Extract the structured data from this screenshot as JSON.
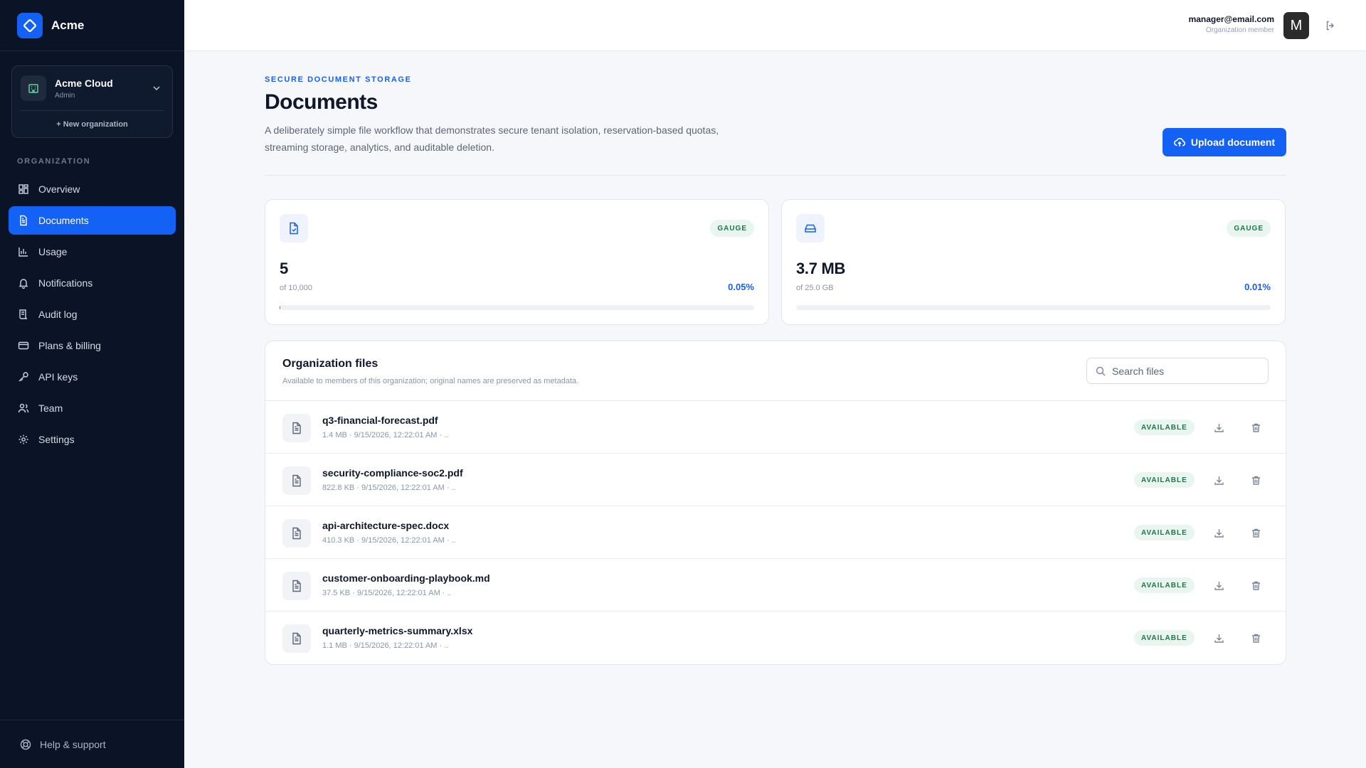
{
  "brand": {
    "name": "Acme",
    "icon": "diamond-logo-icon"
  },
  "organization": {
    "name": "Acme Cloud",
    "role": "Admin",
    "new_label": "+ New organization"
  },
  "sidebar": {
    "heading": "ORGANIZATION",
    "items": [
      {
        "label": "Overview",
        "icon": "grid-icon",
        "active": false
      },
      {
        "label": "Documents",
        "icon": "document-icon",
        "active": true
      },
      {
        "label": "Usage",
        "icon": "bar-chart-icon",
        "active": false
      },
      {
        "label": "Notifications",
        "icon": "bell-icon",
        "active": false
      },
      {
        "label": "Audit log",
        "icon": "scroll-icon",
        "active": false
      },
      {
        "label": "Plans & billing",
        "icon": "credit-card-icon",
        "active": false
      },
      {
        "label": "API keys",
        "icon": "key-icon",
        "active": false
      },
      {
        "label": "Team",
        "icon": "users-icon",
        "active": false
      },
      {
        "label": "Settings",
        "icon": "gear-icon",
        "active": false
      }
    ],
    "footer_label": "Help & support"
  },
  "user": {
    "email": "manager@email.com",
    "role": "Organization member",
    "initial": "M"
  },
  "header": {
    "eyebrow": "SECURE DOCUMENT STORAGE",
    "title": "Documents",
    "description": "A deliberately simple file workflow that demonstrates secure tenant isolation, reservation-based quotas, streaming storage, analytics, and auditable deletion.",
    "upload_label": "Upload document"
  },
  "stats": [
    {
      "icon": "file-check-icon",
      "badge": "GAUGE",
      "value": "5",
      "of": "of 10,000",
      "percent": "0.05%",
      "fill_fraction": 0.0005
    },
    {
      "icon": "hard-drive-icon",
      "badge": "GAUGE",
      "value": "3.7 MB",
      "of": "of 25.0 GB",
      "percent": "0.01%",
      "fill_fraction": 0.0001
    }
  ],
  "files": {
    "title": "Organization files",
    "subtitle": "Available to members of this organization; original names are preserved as metadata.",
    "search_placeholder": "Search files",
    "items": [
      {
        "name": "q3-financial-forecast.pdf",
        "meta": "1.4 MB · 9/15/2026, 12:22:01 AM · ..",
        "status": "AVAILABLE"
      },
      {
        "name": "security-compliance-soc2.pdf",
        "meta": "822.8 KB · 9/15/2026, 12:22:01 AM · ..",
        "status": "AVAILABLE"
      },
      {
        "name": "api-architecture-spec.docx",
        "meta": "410.3 KB · 9/15/2026, 12:22:01 AM · ..",
        "status": "AVAILABLE"
      },
      {
        "name": "customer-onboarding-playbook.md",
        "meta": "37.5 KB · 9/15/2026, 12:22:01 AM · ..",
        "status": "AVAILABLE"
      },
      {
        "name": "quarterly-metrics-summary.xlsx",
        "meta": "1.1 MB · 9/15/2026, 12:22:01 AM · ..",
        "status": "AVAILABLE"
      }
    ]
  },
  "colors": {
    "accent": "#1461f5",
    "sidebar_bg": "#0b1426",
    "status_green": "#167a46",
    "status_green_bg": "#e9f6ef"
  }
}
